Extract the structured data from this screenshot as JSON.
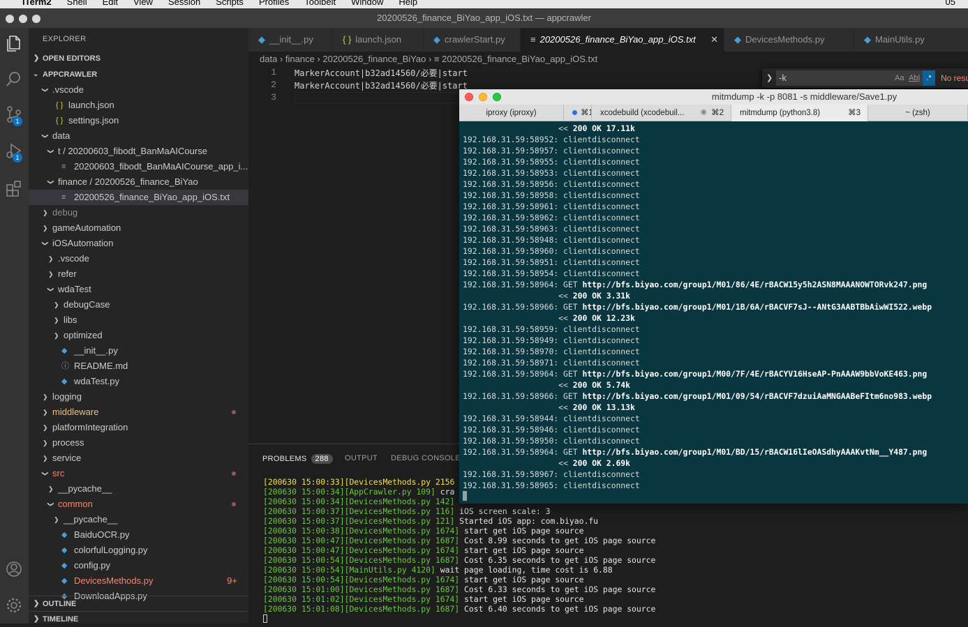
{
  "menubar": {
    "app": "iTerm2",
    "items": [
      "Shell",
      "Edit",
      "View",
      "Session",
      "Scripts",
      "Profiles",
      "Toolbelt",
      "Window",
      "Help"
    ],
    "clock": "05"
  },
  "window_title": "20200526_finance_BiYao_app_iOS.txt — appcrawler",
  "activity": {
    "scm_badge": "1",
    "debug_badge": "1"
  },
  "sidebar": {
    "title": "EXPLORER",
    "open_editors": "OPEN EDITORS",
    "root": "APPCRAWLER",
    "outline": "OUTLINE",
    "timeline": "TIMELINE",
    "tree": [
      {
        "label": ".vscode",
        "depth": 1,
        "type": "folder-open"
      },
      {
        "label": "launch.json",
        "depth": 2,
        "type": "json"
      },
      {
        "label": "settings.json",
        "depth": 2,
        "type": "json"
      },
      {
        "label": "data",
        "depth": 1,
        "type": "folder-open"
      },
      {
        "label": "t / 20200603_fibodt_BanMaAICourse",
        "depth": 2,
        "type": "folder-open"
      },
      {
        "label": "20200603_fibodt_BanMaAICourse_app_i...",
        "depth": 3,
        "type": "txt"
      },
      {
        "label": "finance / 20200526_finance_BiYao",
        "depth": 2,
        "type": "folder-open"
      },
      {
        "label": "20200526_finance_BiYao_app_iOS.txt",
        "depth": 3,
        "type": "txt",
        "selected": true
      },
      {
        "label": "debug",
        "depth": 1,
        "type": "folder",
        "dim": true
      },
      {
        "label": "gameAutomation",
        "depth": 1,
        "type": "folder"
      },
      {
        "label": "iOSAutomation",
        "depth": 1,
        "type": "folder-open"
      },
      {
        "label": ".vscode",
        "depth": 2,
        "type": "folder"
      },
      {
        "label": "refer",
        "depth": 2,
        "type": "folder"
      },
      {
        "label": "wdaTest",
        "depth": 2,
        "type": "folder-open"
      },
      {
        "label": "debugCase",
        "depth": 3,
        "type": "folder"
      },
      {
        "label": "libs",
        "depth": 3,
        "type": "folder"
      },
      {
        "label": "optimized",
        "depth": 3,
        "type": "folder"
      },
      {
        "label": "__init__.py",
        "depth": 3,
        "type": "py"
      },
      {
        "label": "README.md",
        "depth": 3,
        "type": "md"
      },
      {
        "label": "wdaTest.py",
        "depth": 3,
        "type": "py"
      },
      {
        "label": "logging",
        "depth": 1,
        "type": "folder"
      },
      {
        "label": "middleware",
        "depth": 1,
        "type": "folder",
        "modified": true,
        "color": "#e2c08d"
      },
      {
        "label": "platformIntegration",
        "depth": 1,
        "type": "folder"
      },
      {
        "label": "process",
        "depth": 1,
        "type": "folder"
      },
      {
        "label": "service",
        "depth": 1,
        "type": "folder"
      },
      {
        "label": "src",
        "depth": 1,
        "type": "folder-open",
        "modified": true,
        "color": "#f48771"
      },
      {
        "label": "__pycache__",
        "depth": 2,
        "type": "folder"
      },
      {
        "label": "common",
        "depth": 2,
        "type": "folder-open",
        "modified": true,
        "color": "#f48771"
      },
      {
        "label": "__pycache__",
        "depth": 3,
        "type": "folder"
      },
      {
        "label": "BaiduOCR.py",
        "depth": 3,
        "type": "py"
      },
      {
        "label": "colorfulLogging.py",
        "depth": 3,
        "type": "py"
      },
      {
        "label": "config.py",
        "depth": 3,
        "type": "py"
      },
      {
        "label": "DevicesMethods.py",
        "depth": 3,
        "type": "py",
        "color": "#f48771",
        "suffix": "9+"
      },
      {
        "label": "DownloadApps.py",
        "depth": 3,
        "type": "py"
      }
    ]
  },
  "tabs": [
    {
      "label": "__init__.py",
      "icon": "py"
    },
    {
      "label": "launch.json",
      "icon": "json"
    },
    {
      "label": "crawlerStart.py",
      "icon": "py"
    },
    {
      "label": "20200526_finance_BiYao_app_iOS.txt",
      "icon": "txt",
      "active": true
    },
    {
      "label": "DevicesMethods.py",
      "icon": "py"
    },
    {
      "label": "MainUtils.py",
      "icon": "py"
    }
  ],
  "breadcrumb": [
    "data",
    "finance",
    "20200526_finance_BiYao",
    "20200526_finance_BiYao_app_iOS.txt"
  ],
  "editor_lines": [
    {
      "n": "1",
      "text": "MarkerAccount|b32ad14560/必要|start"
    },
    {
      "n": "2",
      "text": "MarkerAccount|b32ad14560/必要|start"
    },
    {
      "n": "3",
      "text": ""
    }
  ],
  "find": {
    "value": "-k",
    "case": "Aa",
    "word": "Ab|",
    "regex": ".*",
    "result": "No results"
  },
  "panel": {
    "tabs": [
      "PROBLEMS",
      "OUTPUT",
      "DEBUG CONSOLE"
    ],
    "problems_count": "288",
    "logs": [
      {
        "ts": "[200630 15:00:33][DevicesMethods.py 2156",
        "msg": "",
        "yellow": true
      },
      {
        "ts": "[200630 15:00:34][AppCrawler.py 109]",
        "msg": " cra"
      },
      {
        "ts": "[200630 15:00:34][DevicesMethods.py 142]",
        "msg": ""
      },
      {
        "ts": "[200630 15:00:37][DevicesMethods.py 116]",
        "msg": " iOS screen scale: 3"
      },
      {
        "ts": "[200630 15:00:37][DevicesMethods.py 121]",
        "msg": " Started iOS app: com.biyao.fu"
      },
      {
        "ts": "[200630 15:00:38][DevicesMethods.py 1674]",
        "msg": " start get iOS page source"
      },
      {
        "ts": "[200630 15:00:47][DevicesMethods.py 1687]",
        "msg": " Cost 8.99 seconds to get iOS page source"
      },
      {
        "ts": "[200630 15:00:47][DevicesMethods.py 1674]",
        "msg": " start get iOS page source"
      },
      {
        "ts": "[200630 15:00:54][DevicesMethods.py 1687]",
        "msg": " Cost 6.35 seconds to get iOS page source"
      },
      {
        "ts": "[200630 15:00:54][MainUtils.py 4120]",
        "msg": " wait page loading, time cost is 6.88"
      },
      {
        "ts": "[200630 15:00:54][DevicesMethods.py 1674]",
        "msg": " start get iOS page source"
      },
      {
        "ts": "[200630 15:01:00][DevicesMethods.py 1687]",
        "msg": " Cost 6.33 seconds to get iOS page source"
      },
      {
        "ts": "[200630 15:01:02][DevicesMethods.py 1674]",
        "msg": " start get iOS page source"
      },
      {
        "ts": "[200630 15:01:08][DevicesMethods.py 1687]",
        "msg": " Cost 6.40 seconds to get iOS page source"
      }
    ]
  },
  "iterm": {
    "title": "mitmdump -k -p 8081 -s middleware/Save1.py",
    "tabs": [
      {
        "label": "iproxy (iproxy)",
        "shortcut": ""
      },
      {
        "label": "⌘1",
        "shortcut": "",
        "dot": true
      },
      {
        "label": "xcodebuild (xcodebuil...",
        "shortcut": "⌘2",
        "spinner": true
      },
      {
        "label": "mitmdump (python3.8)",
        "shortcut": "⌘3",
        "active": true
      },
      {
        "label": "~ (zsh)",
        "shortcut": ""
      }
    ],
    "lines": [
      {
        "pre": "                    << ",
        "bold": "200 OK 17.11k"
      },
      {
        "pre": "192.168.31.59:58952: clientdisconnect",
        "bold": ""
      },
      {
        "pre": "192.168.31.59:58957: clientdisconnect",
        "bold": ""
      },
      {
        "pre": "192.168.31.59:58955: clientdisconnect",
        "bold": ""
      },
      {
        "pre": "192.168.31.59:58953: clientdisconnect",
        "bold": ""
      },
      {
        "pre": "192.168.31.59:58956: clientdisconnect",
        "bold": ""
      },
      {
        "pre": "192.168.31.59:58958: clientdisconnect",
        "bold": ""
      },
      {
        "pre": "192.168.31.59:58961: clientdisconnect",
        "bold": ""
      },
      {
        "pre": "192.168.31.59:58962: clientdisconnect",
        "bold": ""
      },
      {
        "pre": "192.168.31.59:58963: clientdisconnect",
        "bold": ""
      },
      {
        "pre": "192.168.31.59:58948: clientdisconnect",
        "bold": ""
      },
      {
        "pre": "192.168.31.59:58960: clientdisconnect",
        "bold": ""
      },
      {
        "pre": "192.168.31.59:58951: clientdisconnect",
        "bold": ""
      },
      {
        "pre": "192.168.31.59:58954: clientdisconnect",
        "bold": ""
      },
      {
        "pre": "192.168.31.59:58964: GET ",
        "bold": "http://bfs.biyao.com/group1/M01/86/4E/rBACW15y5h2ASN8MAAANOWTORvk247.png"
      },
      {
        "pre": "                    << ",
        "bold": "200 OK 3.31k"
      },
      {
        "pre": "192.168.31.59:58966: GET ",
        "bold": "http://bfs.biyao.com/group1/M01/1B/6A/rBACVF7sJ--ANtG3AABTBbAiwWI522.webp"
      },
      {
        "pre": "                    << ",
        "bold": "200 OK 12.23k"
      },
      {
        "pre": "192.168.31.59:58959: clientdisconnect",
        "bold": ""
      },
      {
        "pre": "192.168.31.59:58949: clientdisconnect",
        "bold": ""
      },
      {
        "pre": "192.168.31.59:58970: clientdisconnect",
        "bold": ""
      },
      {
        "pre": "192.168.31.59:58971: clientdisconnect",
        "bold": ""
      },
      {
        "pre": "192.168.31.59:58964: GET ",
        "bold": "http://bfs.biyao.com/group1/M00/7F/4E/rBACYV16HseAP-PnAAAW9bbVoKE463.png"
      },
      {
        "pre": "                    << ",
        "bold": "200 OK 5.74k"
      },
      {
        "pre": "192.168.31.59:58966: GET ",
        "bold": "http://bfs.biyao.com/group1/M01/09/54/rBACVF7dzuiAaMNGAABeFItm6no983.webp"
      },
      {
        "pre": "                    << ",
        "bold": "200 OK 13.13k"
      },
      {
        "pre": "192.168.31.59:58944: clientdisconnect",
        "bold": ""
      },
      {
        "pre": "192.168.31.59:58946: clientdisconnect",
        "bold": ""
      },
      {
        "pre": "192.168.31.59:58950: clientdisconnect",
        "bold": ""
      },
      {
        "pre": "192.168.31.59:58964: GET ",
        "bold": "http://bfs.biyao.com/group1/M01/BD/15/rBACW16lIeOASdhyAAAKvtNm__Y487.png"
      },
      {
        "pre": "                    << ",
        "bold": "200 OK 2.69k"
      },
      {
        "pre": "192.168.31.59:58967: clientdisconnect",
        "bold": ""
      },
      {
        "pre": "192.168.31.59:58965: clientdisconnect",
        "bold": ""
      }
    ]
  },
  "colors": {
    "accent": "#0e70c0",
    "terminal_bg": "#0a3640",
    "modified": "#f48771"
  }
}
